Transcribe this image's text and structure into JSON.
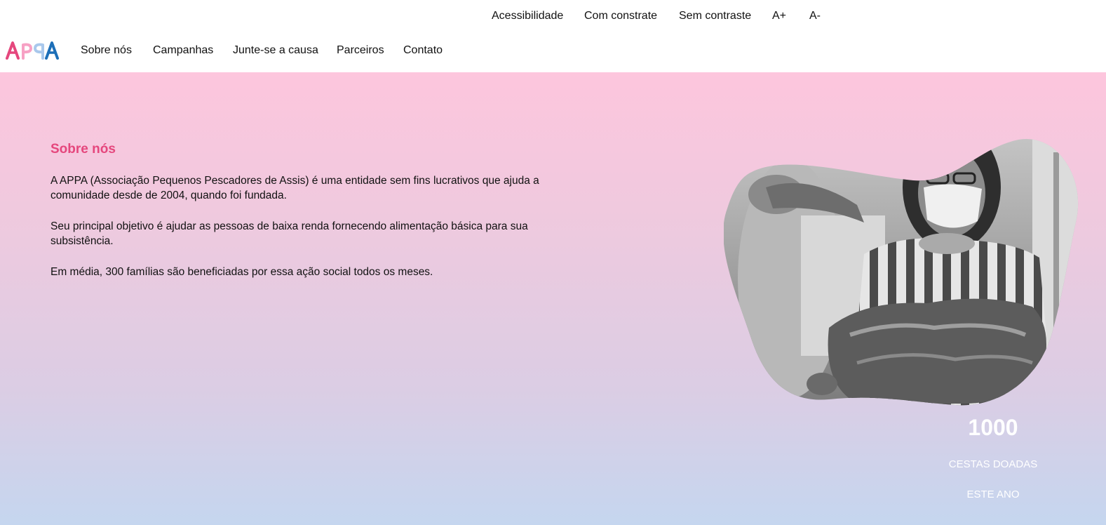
{
  "accessibility_bar": {
    "items": [
      "Acessibilidade",
      "Com constrate",
      "Sem contraste",
      "A+",
      "A-"
    ]
  },
  "logo": {
    "text": "APPA",
    "colors": [
      "#e5477d",
      "#f7a1c4",
      "#a9c8ec",
      "#1d6fb8"
    ]
  },
  "nav": {
    "items": [
      "Sobre nós",
      "Campanhas",
      "Junte-se a causa",
      "Parceiros",
      "Contato"
    ]
  },
  "about": {
    "title": "Sobre nós",
    "paragraphs": [
      "A APPA (Associação Pequenos Pescadores de Assis) é uma entidade sem fins lucrativos que ajuda a comunidade desde de 2004, quando foi fundada.",
      "Seu principal objetivo é ajudar as pessoas de baixa renda fornecendo alimentação básica para sua subsistência.",
      "Em média, 300 famílias são beneficiadas por essa ação social todos os meses."
    ]
  },
  "stats": {
    "number": "1000",
    "line1": "CESTAS DOADAS",
    "line2": "ESTE ANO"
  },
  "colors": {
    "accent_pink": "#e5477d",
    "gradient_top": "#fdc6dd",
    "gradient_bottom": "#c5d6ef",
    "stat_text": "#ffffff"
  }
}
